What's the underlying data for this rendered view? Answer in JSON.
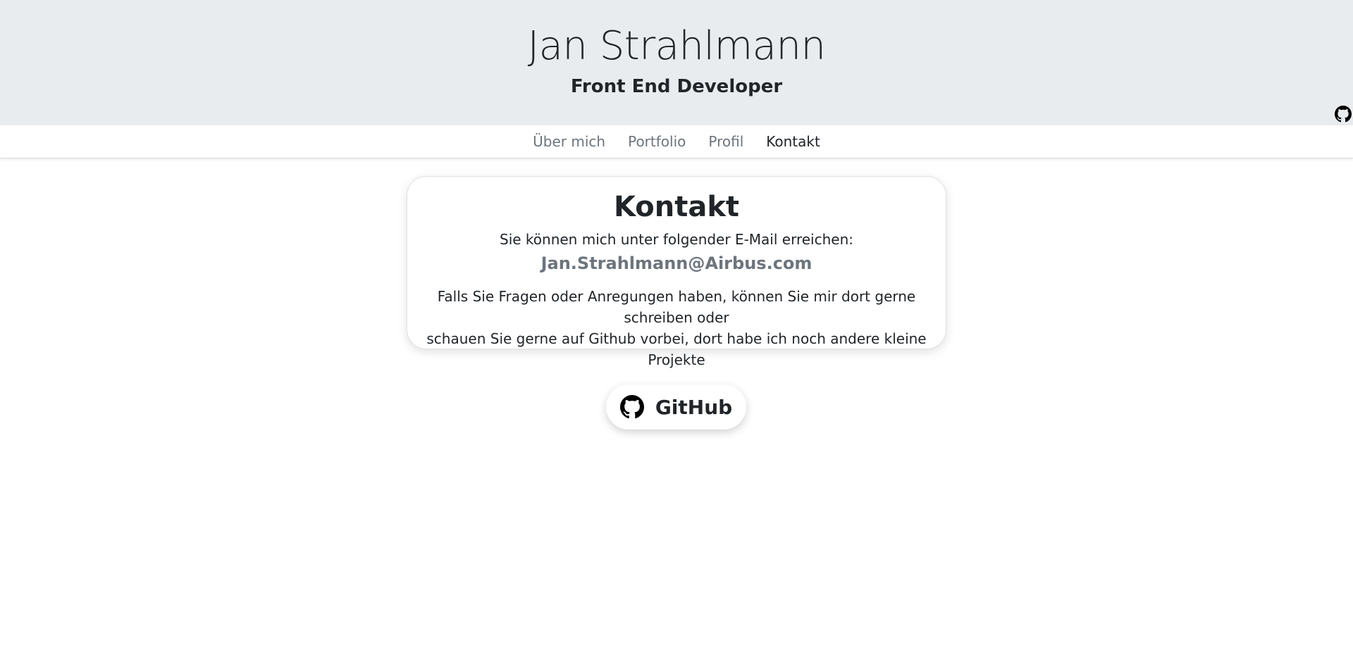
{
  "header": {
    "title": "Jan Strahlmann",
    "subtitle": "Front End Developer"
  },
  "nav": {
    "items": [
      {
        "label": "Über mich",
        "active": false
      },
      {
        "label": "Portfolio",
        "active": false
      },
      {
        "label": "Profil",
        "active": false
      },
      {
        "label": "Kontakt",
        "active": true
      }
    ]
  },
  "contact": {
    "title": "Kontakt",
    "intro": "Sie können mich unter folgender E-Mail erreichen:",
    "email": "Jan.Strahlmann@Airbus.com",
    "body_line1": "Falls Sie Fragen oder Anregungen haben, können Sie mir dort gerne schreiben oder",
    "body_line2": "schauen Sie gerne auf Github vorbei, dort habe ich noch andere kleine Projekte"
  },
  "github_button": {
    "label": "GitHub",
    "icon": "github-icon"
  },
  "corner": {
    "icon": "github-icon"
  },
  "colors": {
    "header_bg": "#e9ecef",
    "text": "#212529",
    "muted": "#6c757d"
  }
}
